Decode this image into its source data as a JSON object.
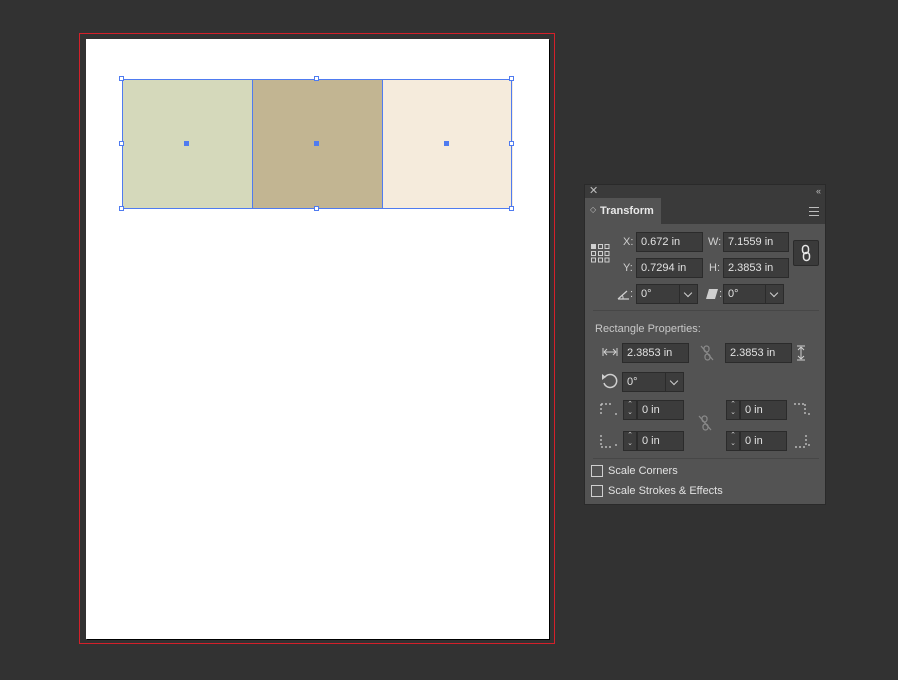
{
  "canvas": {
    "swatch_colors": [
      "#d5d9bb",
      "#c2b592",
      "#f5ebdc"
    ],
    "selection_color": "#4f7bf0",
    "bleed_color": "#d4202a"
  },
  "panel": {
    "title": "Transform",
    "close_icon": "close-icon",
    "collapse_icon": "double-chevron-icon",
    "menu_icon": "hamburger-menu-icon",
    "x_label": "X:",
    "x_value": "0.672 in",
    "y_label": "Y:",
    "y_value": "0.7294 in",
    "w_label": "W:",
    "w_value": "7.1559 in",
    "h_label": "H:",
    "h_value": "2.3853 in",
    "rotate_label": ":",
    "rotate_value": "0°",
    "shear_label": ":",
    "shear_value": "0°",
    "rect_title": "Rectangle Properties:",
    "rect_width": "2.3853 in",
    "rect_height": "2.3853 in",
    "rect_rotate": "0°",
    "corner_tl": "0 in",
    "corner_tr": "0 in",
    "corner_bl": "0 in",
    "corner_br": "0 in",
    "scale_corners": "Scale Corners",
    "scale_strokes": "Scale Strokes & Effects"
  }
}
